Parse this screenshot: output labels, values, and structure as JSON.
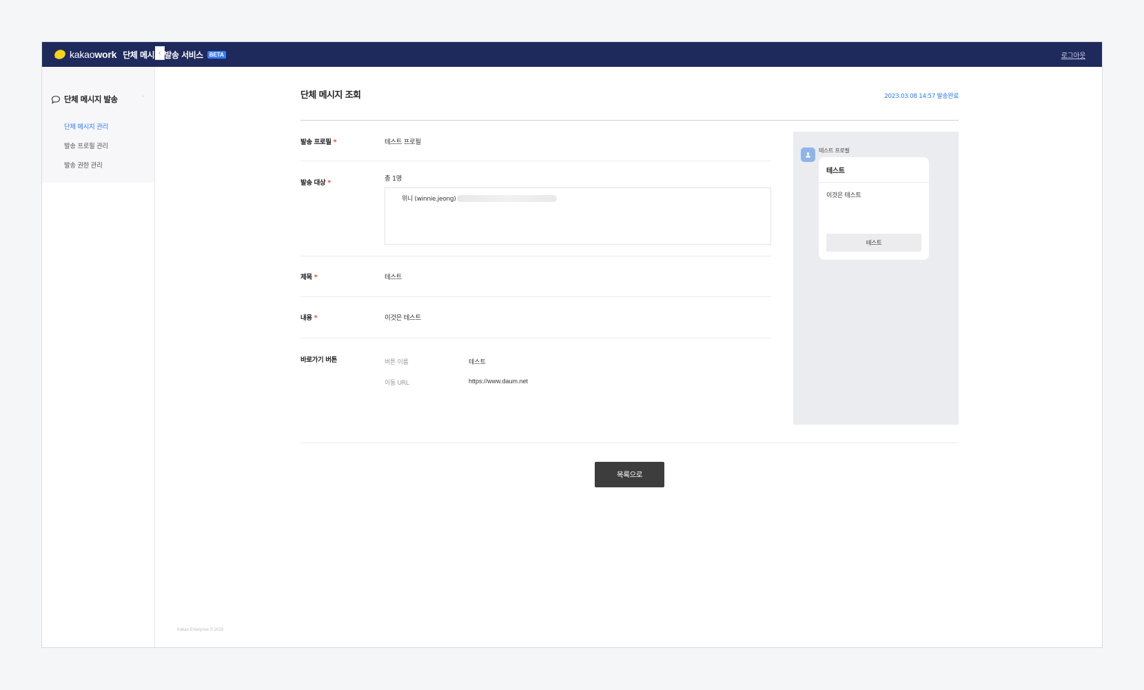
{
  "header": {
    "brand_prefix": "kakao",
    "brand_suffix": "work",
    "service_title": "단체 메시지 발송 서비스",
    "beta_badge": "BETA",
    "logout_label": "로그아웃"
  },
  "sidebar": {
    "section_label": "단체 메시지 발송",
    "items": [
      {
        "label": "단체 메시지 관리",
        "active": true
      },
      {
        "label": "발송 프로필 관리",
        "active": false
      },
      {
        "label": "발송 권한 관리",
        "active": false
      }
    ],
    "collapse_icon": "‹",
    "footer": "Kakao Enterprise © 2023"
  },
  "page": {
    "title": "단체 메시지 조회",
    "sent_status": "2023.03.08 14:57 발송완료"
  },
  "form": {
    "required_mark": "*",
    "profile": {
      "label": "발송 프로필",
      "value": "테스트 프로필"
    },
    "recipients": {
      "label": "발송 대상",
      "count": "총 1명",
      "items": [
        "위니 (winnie.jeong)"
      ]
    },
    "subject": {
      "label": "제목",
      "value": "테스트"
    },
    "content": {
      "label": "내용",
      "value": "이것은 테스트"
    },
    "shortcut": {
      "label": "바로가기 버튼",
      "button_name_label": "버튼 이름",
      "button_name_value": "테스트",
      "url_label": "이동 URL",
      "url_value": "https://www.daum.net"
    }
  },
  "preview": {
    "profile_name": "테스트 프로필",
    "card_title": "테스트",
    "card_body": "이것은 테스트",
    "card_button": "테스트"
  },
  "actions": {
    "back_to_list": "목록으로"
  },
  "colors": {
    "header_bg": "#1f2a5c",
    "accent": "#2f7af4",
    "required": "#f04438",
    "primary_button": "#3d3d3d"
  }
}
